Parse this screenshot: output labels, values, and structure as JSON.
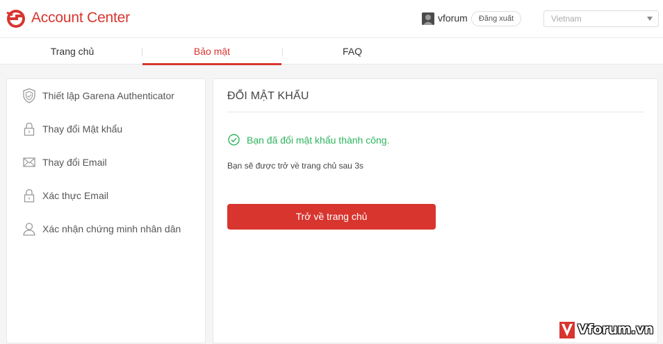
{
  "header": {
    "brand": "Account Center",
    "username": "vforum",
    "logout_label": "Đăng xuất",
    "region_value": "Vietnam"
  },
  "nav": {
    "tabs": [
      {
        "label": "Trang chủ",
        "active": false
      },
      {
        "label": "Bảo mật",
        "active": true
      },
      {
        "label": "FAQ",
        "active": false
      }
    ]
  },
  "sidebar": {
    "items": [
      {
        "label": "Thiết lập Garena Authenticator",
        "icon": "shield-icon"
      },
      {
        "label": "Thay đổi Mật khẩu",
        "icon": "lock-icon"
      },
      {
        "label": "Thay đổi Email",
        "icon": "envelope-icon"
      },
      {
        "label": "Xác thực Email",
        "icon": "lock-icon"
      },
      {
        "label": "Xác nhận chứng minh nhân dân",
        "icon": "user-icon"
      }
    ]
  },
  "main": {
    "title": "ĐỔI MẬT KHẨU",
    "success_message": "Bạn đã đổi mật khẩu thành công.",
    "redirect_message": "Bạn sẽ được trở về trang chủ sau 3s",
    "home_button_label": "Trở về trang chủ"
  },
  "watermark": {
    "text": "Vforum.vn"
  },
  "colors": {
    "accent": "#d8352f",
    "success": "#2db55d"
  }
}
